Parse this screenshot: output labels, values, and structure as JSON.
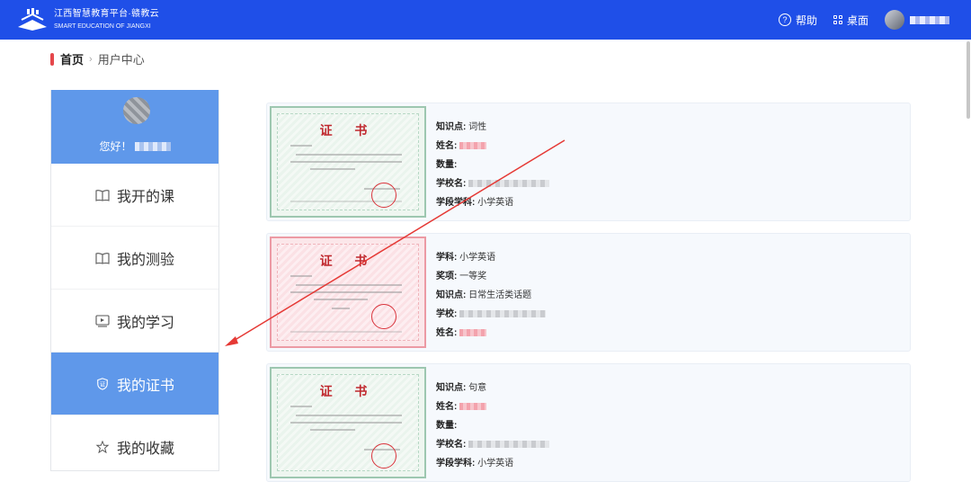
{
  "header": {
    "brand_cn": "江西智慧教育平台·赣教云",
    "brand_en": "SMART EDUCATION OF JIANGXI",
    "help_label": "帮助",
    "desk_label": "桌面",
    "bg_color": "#1f4fe8"
  },
  "breadcrumb": {
    "home": "首页",
    "separator": "›",
    "current": "用户中心"
  },
  "sidebar": {
    "greeting": "您好！",
    "items": [
      {
        "label": "我开的课",
        "icon": "book-icon",
        "active": false
      },
      {
        "label": "我的测验",
        "icon": "book-icon",
        "active": false
      },
      {
        "label": "我的学习",
        "icon": "video-icon",
        "active": false
      },
      {
        "label": "我的证书",
        "icon": "shield-icon",
        "active": true
      },
      {
        "label": "我的收藏",
        "icon": "star-icon",
        "active": false
      }
    ],
    "accent_color": "#5f98ea"
  },
  "certificates": [
    {
      "cert_title": "证 书",
      "style": "green",
      "fields": [
        {
          "label": "知识点:",
          "value": "词性"
        },
        {
          "label": "姓名:",
          "value": ""
        },
        {
          "label": "数量:",
          "value": ""
        },
        {
          "label": "学校名:",
          "value": ""
        },
        {
          "label": "学段学科:",
          "value": "小学英语"
        }
      ]
    },
    {
      "cert_title": "证 书",
      "style": "red",
      "fields": [
        {
          "label": "学科:",
          "value": "小学英语"
        },
        {
          "label": "奖项:",
          "value": "一等奖"
        },
        {
          "label": "知识点:",
          "value": "日常生活类话题"
        },
        {
          "label": "学校:",
          "value": ""
        },
        {
          "label": "姓名:",
          "value": ""
        }
      ]
    },
    {
      "cert_title": "证 书",
      "style": "green",
      "fields": [
        {
          "label": "知识点:",
          "value": "句意"
        },
        {
          "label": "姓名:",
          "value": ""
        },
        {
          "label": "数量:",
          "value": ""
        },
        {
          "label": "学校名:",
          "value": ""
        },
        {
          "label": "学段学科:",
          "value": "小学英语"
        }
      ]
    }
  ]
}
